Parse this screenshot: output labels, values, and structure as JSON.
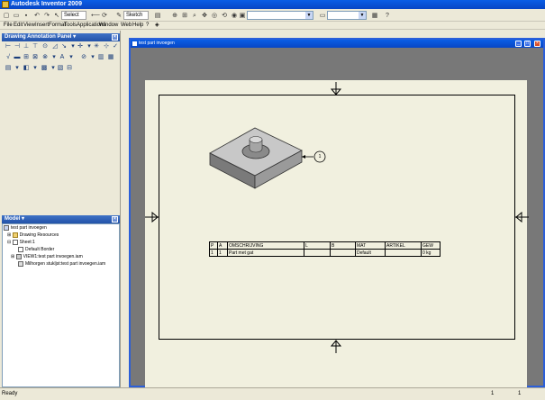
{
  "app": {
    "title": "Autodesk Inventor 2009"
  },
  "toolbar": {
    "select_label": "Select",
    "sketch_label": "Sketch",
    "dropdown_value": ""
  },
  "menu": {
    "items": [
      "File",
      "Edit",
      "View",
      "Insert",
      "Format",
      "Tools",
      "Applications",
      "Window",
      "Web",
      "Help"
    ]
  },
  "annotation_panel": {
    "title": "Drawing Annotation Panel ▾"
  },
  "model_panel": {
    "title": "Model ▾",
    "tree": [
      {
        "label": "test part invoegen"
      },
      {
        "label": "Drawing Resources"
      },
      {
        "label": "Sheet:1"
      },
      {
        "label": "Default Border"
      },
      {
        "label": "VIEW1:test part invoegen.iam"
      },
      {
        "label": "Milhorgen stukljst:test part invoegen.iam"
      }
    ]
  },
  "document": {
    "title": "test part invoegen",
    "balloon": "1"
  },
  "bom": {
    "headers": [
      "P",
      "A",
      "OMSCHRIJVING",
      "L",
      "B",
      "MAT",
      "ARTIKEL",
      "GEW"
    ],
    "rows": [
      [
        "1",
        "1",
        "Part met gat",
        "",
        "",
        "Default",
        "",
        "0 kg"
      ]
    ]
  },
  "status": {
    "text": "Ready",
    "counts": [
      "1",
      "1"
    ]
  }
}
